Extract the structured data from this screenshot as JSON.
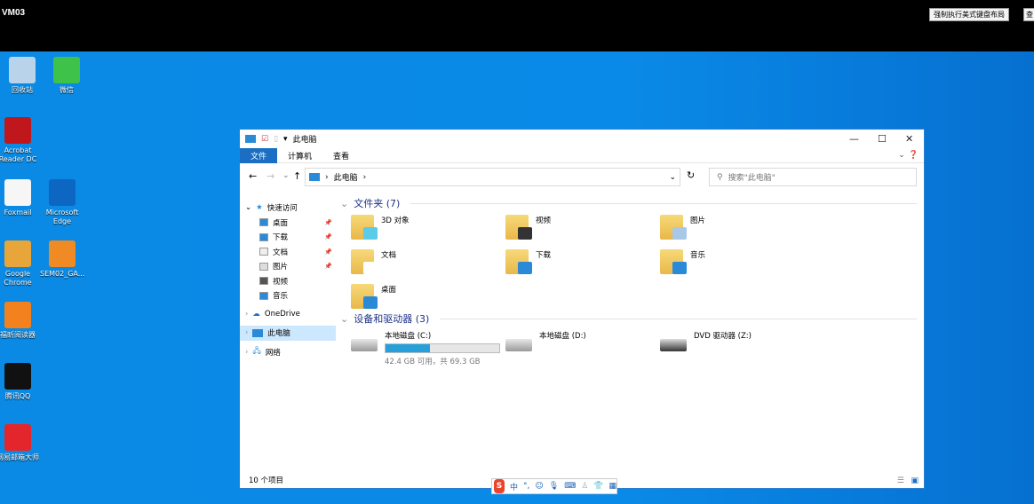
{
  "topbar": {
    "vm_name": "VM03",
    "keyboard_button": "强制执行美式键盘布局",
    "cut_button": "查"
  },
  "desktop": {
    "icons": [
      {
        "label": "回收站",
        "color": "#b9d4ea"
      },
      {
        "label": "微信",
        "color": "#3ec24a"
      },
      {
        "label": "Acrobat Reader DC",
        "color": "#c0171c"
      },
      {
        "label": "Foxmail",
        "color": "#f6f6f6"
      },
      {
        "label": "Microsoft Edge",
        "color": "#0c66c2"
      },
      {
        "label": "Google Chrome",
        "color": "#e8a53a"
      },
      {
        "label": "SEM02_GA...",
        "color": "#f08a24"
      },
      {
        "label": "福昕阅读器",
        "color": "#f2811e"
      },
      {
        "label": "腾讯QQ",
        "color": "#111111"
      },
      {
        "label": "网易邮箱大师",
        "color": "#e3262b"
      }
    ]
  },
  "explorer": {
    "title": "此电脑",
    "tabs": [
      "文件",
      "计算机",
      "查看"
    ],
    "breadcrumb": "此电脑",
    "search_placeholder": "搜索\"此电脑\"",
    "nav": {
      "quick_access": "快速访问",
      "quick_items": [
        "桌面",
        "下载",
        "文档",
        "图片",
        "视频",
        "音乐"
      ],
      "onedrive": "OneDrive",
      "this_pc": "此电脑",
      "network": "网络"
    },
    "folders_header": "文件夹 (7)",
    "folders": [
      "3D 对象",
      "视频",
      "图片",
      "文档",
      "下载",
      "音乐",
      "桌面"
    ],
    "drives_header": "设备和驱动器 (3)",
    "drives": [
      {
        "name": "本地磁盘 (C:)",
        "free": "42.4 GB 可用，共 69.3 GB",
        "used_fraction": 0.39
      },
      {
        "name": "本地磁盘 (D:)"
      },
      {
        "name": "DVD 驱动器 (Z:)"
      }
    ],
    "status": "10 个项目"
  },
  "ime": {
    "logo": "S",
    "mode": "中",
    "punct": "°,"
  }
}
